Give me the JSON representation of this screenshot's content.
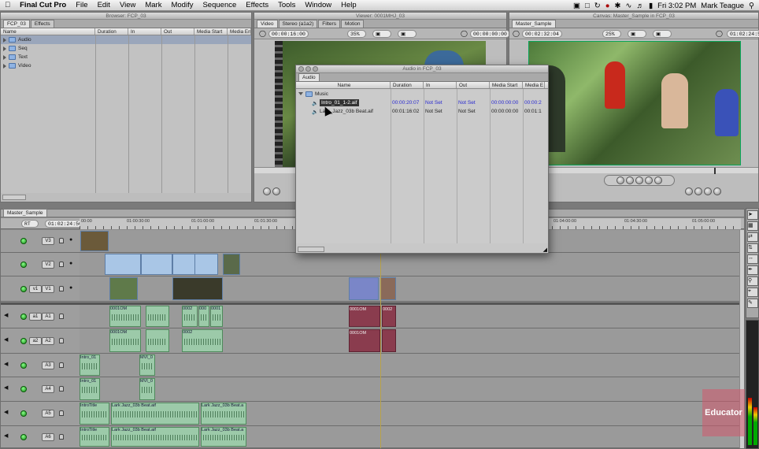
{
  "menubar": {
    "app_name": "Final Cut Pro",
    "items": [
      "File",
      "Edit",
      "View",
      "Mark",
      "Modify",
      "Sequence",
      "Effects",
      "Tools",
      "Window",
      "Help"
    ],
    "clock": "Fri 3:02 PM",
    "user": "Mark Teague"
  },
  "browser": {
    "title": "Browser: FCP_03",
    "tabs": [
      "FCP_03",
      "Effects"
    ],
    "columns": [
      "Name",
      "Duration",
      "In",
      "Out",
      "Media Start",
      "Media En"
    ],
    "items": [
      "Audio",
      "Seq",
      "Text",
      "Video"
    ]
  },
  "viewer": {
    "title": "Viewer: 0001MHJ_03",
    "tabs": [
      "Video",
      "Stereo (a1a2)",
      "Filters",
      "Motion"
    ],
    "timecode": "00:00:16:00",
    "zoom": "35%",
    "timecode_right": "00:00:00:00"
  },
  "canvas": {
    "title": "Canvas: Master_Sample in FCP_03",
    "tab": "Master_Sample",
    "timecode": "00:02:32:04",
    "zoom": "25%",
    "timecode_right": "01:02:24:50"
  },
  "audio_bin": {
    "title": "Audio in FCP_03",
    "tab": "Audio",
    "columns": [
      "Name",
      "Duration",
      "In",
      "Out",
      "Media Start",
      "Media E"
    ],
    "folder": "Music",
    "rows": [
      {
        "name": "Intro_01_1-2.aif",
        "duration": "00:00:20:07",
        "in": "Not Set",
        "out": "Not Set",
        "media_start": "00:00:00:00",
        "media_end": "00:00:2"
      },
      {
        "name": "Lark_Jazz_03b Beat.aif",
        "duration": "00:01:16:02",
        "in": "Not Set",
        "out": "Not Set",
        "media_start": "00:00:00:00",
        "media_end": "00:01:1"
      }
    ]
  },
  "timeline": {
    "tab": "Master_Sample",
    "rt": "RT",
    "timecode": "01:02:24:50",
    "ruler": [
      "00:00",
      "01:00:30:00",
      "01:01:00:00",
      "01:01:30:00",
      "01:04:00:00",
      "01:04:30:00",
      "01:05:00:00"
    ],
    "video_tracks": [
      {
        "src": "",
        "dest": "V3"
      },
      {
        "src": "",
        "dest": "V2"
      },
      {
        "src": "v1",
        "dest": "V1"
      }
    ],
    "audio_tracks": [
      {
        "src": "a1",
        "dest": "A1"
      },
      {
        "src": "a2",
        "dest": "A2"
      },
      {
        "src": "",
        "dest": "A3"
      },
      {
        "src": "",
        "dest": "A4"
      },
      {
        "src": "",
        "dest": "A5"
      },
      {
        "src": "",
        "dest": "A6"
      }
    ],
    "clip_labels": {
      "a1_c1": "0001OM",
      "a1_c2": "0002",
      "a1_c3": "000",
      "a1_c4": "0001",
      "a1_c5": "0001OM",
      "a1_c6": "0002",
      "a2_c1": "0001OM",
      "a2_c2": "0002",
      "a2_c3": "0001OM",
      "a3_c1": "Intro_01",
      "a3_c2": "MVI_0",
      "a4_c1": "Intro_01",
      "a4_c2": "MVI_0",
      "a5_c1": "IntroTitle",
      "a5_c2": "Lark Jazz_03b Beat.aif",
      "a5_c3": "Lark Jazz_03b Beat.a",
      "a6_c1": "IntroTitle",
      "a6_c2": "Lark Jazz_03b Beat.aif",
      "a6_c3": "Lark Jazz_03b Beat.a"
    }
  },
  "watermark": "Educator"
}
